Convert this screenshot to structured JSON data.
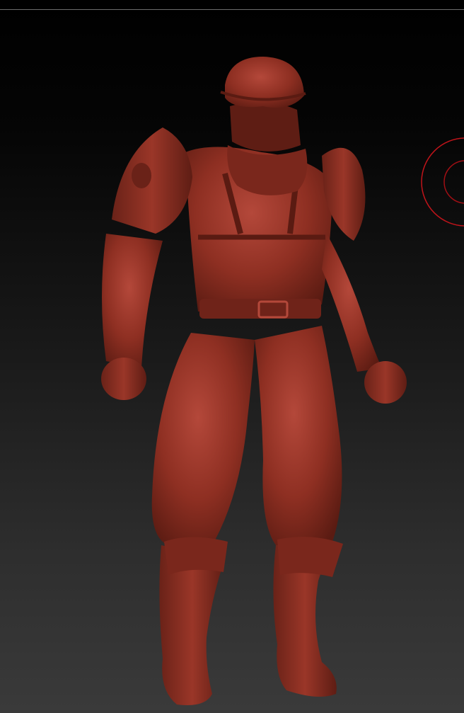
{
  "viewport": {
    "background_top": "#000000",
    "background_bottom": "#3a3a3a"
  },
  "model": {
    "subject": "sculpted-soldier-figure",
    "material_color": "#8e2f22",
    "shadow_color": "#5a1b12",
    "highlight_color": "#b4483a"
  },
  "brush_cursor": {
    "outer_ring_color": "#c0141a",
    "inner_ring_color": "#a00f14"
  }
}
